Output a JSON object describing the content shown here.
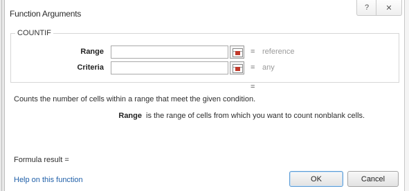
{
  "dialog": {
    "title": "Function Arguments",
    "help_button": "?",
    "close_button": "✕"
  },
  "function": {
    "name": "COUNTIF",
    "arguments": [
      {
        "label": "Range",
        "value": "",
        "evaluated": "reference"
      },
      {
        "label": "Criteria",
        "value": "",
        "evaluated": "any"
      }
    ],
    "result_equals": "=",
    "description": "Counts the number of cells within a range that meet the given condition.",
    "current_arg_name": "Range",
    "current_arg_description": "is the range of cells from which you want to count nonblank cells."
  },
  "footer": {
    "formula_result": "Formula result =",
    "help_link": "Help on this function",
    "ok_label": "OK",
    "cancel_label": "Cancel"
  },
  "icons": {
    "ref_button": "collapse-dialog-icon"
  },
  "colors": {
    "link": "#1f5fa8",
    "ok_border": "#5b9bd5"
  }
}
